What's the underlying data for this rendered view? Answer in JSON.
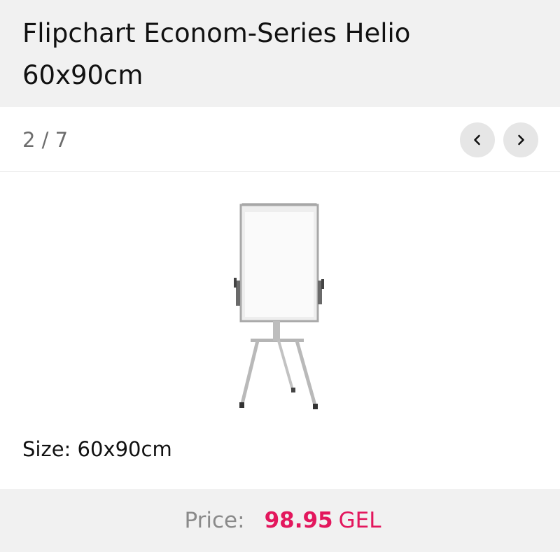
{
  "product": {
    "title_line1": "Flipchart Econom-Series Helio",
    "title_line2": "60x90cm",
    "size_label": "Size:",
    "size_value": "60x90cm"
  },
  "gallery": {
    "counter": "2 / 7",
    "prev_icon": "chevron-left-icon",
    "next_icon": "chevron-right-icon"
  },
  "price": {
    "label": "Price:",
    "value": "98.95",
    "currency": "GEL",
    "accent_color": "#e3175d"
  }
}
